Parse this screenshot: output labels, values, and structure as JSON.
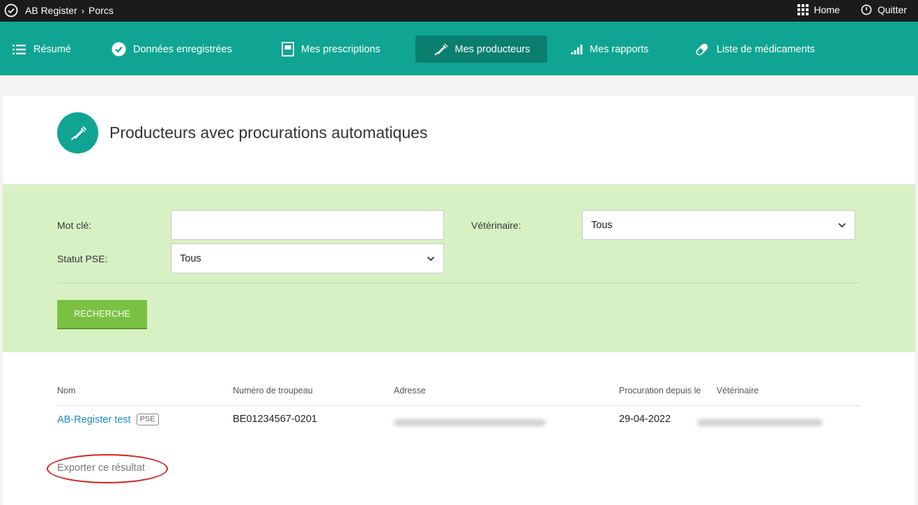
{
  "topbar": {
    "crumb_app": "AB Register",
    "crumb_sep": "›",
    "crumb_section": "Porcs",
    "home_label": "Home",
    "quit_label": "Quitter"
  },
  "nav": {
    "items": [
      {
        "label": "Résumé",
        "icon": "list-icon"
      },
      {
        "label": "Données enregistrées",
        "icon": "check-circle-icon"
      },
      {
        "label": "Mes prescriptions",
        "icon": "document-icon"
      },
      {
        "label": "Mes producteurs",
        "icon": "syringe-icon",
        "active": true
      },
      {
        "label": "Mes rapports",
        "icon": "bar-chart-icon"
      },
      {
        "label": "Liste de médicaments",
        "icon": "pill-icon"
      }
    ]
  },
  "page": {
    "title": "Producteurs avec procurations automatiques"
  },
  "filters": {
    "keyword_label": "Mot clé:",
    "keyword_value": "",
    "vet_label": "Vétérinaire:",
    "vet_value": "Tous",
    "pse_label": "Statut PSE:",
    "pse_value": "Tous",
    "search_button": "RECHERCHE"
  },
  "table": {
    "headers": [
      "Nom",
      "Numéro de troupeau",
      "Adresse",
      "Procuration depuis le",
      "Vétérinaire"
    ],
    "rows": [
      {
        "name": "AB-Register test",
        "badge": "PSE",
        "herd": "BE01234567-0201",
        "address": "",
        "since": "29-04-2022",
        "vet": ""
      }
    ]
  },
  "export_label": "Exporter ce résultat",
  "colors": {
    "teal": "#0fa592",
    "teal_active": "#0b7e6f",
    "green_button": "#7ac143",
    "filter_bg": "#d8f1c4",
    "link": "#1d8fc9",
    "annotation": "#d42222"
  }
}
